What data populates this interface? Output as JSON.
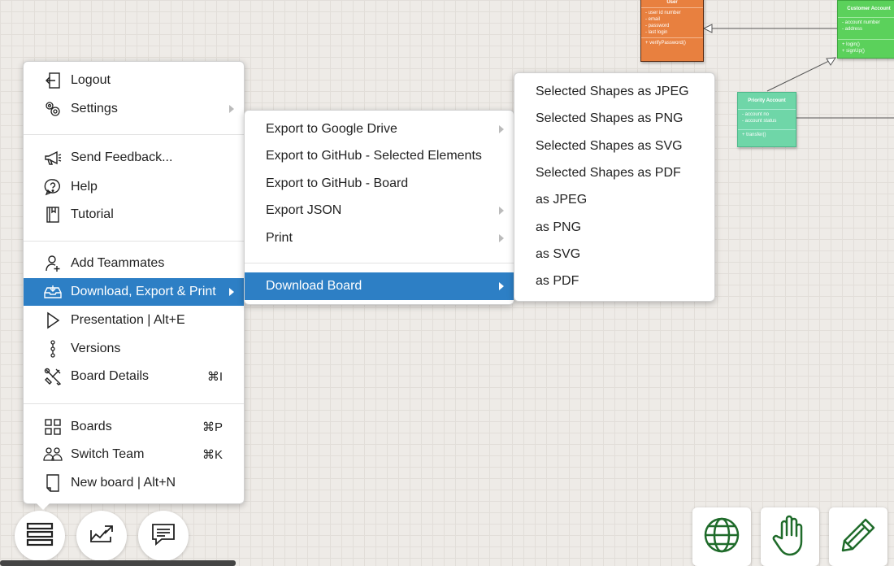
{
  "diagram": {
    "user": {
      "title": "User",
      "attrs": [
        "- user id number",
        "- email",
        "- password",
        "- last login"
      ],
      "methods": [
        "+ verifyPassword()"
      ]
    },
    "customer": {
      "title": "Customer Account",
      "attrs": [
        "- account number",
        "- address"
      ],
      "methods": [
        "+ login()",
        "+ signUp()"
      ]
    },
    "priority": {
      "title": "Priority Account",
      "attrs": [
        "- account no",
        "- account status"
      ],
      "methods": [
        "+ transfer()"
      ]
    }
  },
  "main_menu": {
    "logout": "Logout",
    "settings": "Settings",
    "send_feedback": "Send Feedback...",
    "help": "Help",
    "tutorial": "Tutorial",
    "add_teammates": "Add Teammates",
    "download_export_print": "Download, Export & Print",
    "presentation": "Presentation | Alt+E",
    "versions": "Versions",
    "board_details": "Board Details",
    "board_details_shortcut": "⌘I",
    "boards": "Boards",
    "boards_shortcut": "⌘P",
    "switch_team": "Switch Team",
    "switch_team_shortcut": "⌘K",
    "new_board": "New board | Alt+N"
  },
  "export_menu": {
    "google_drive": "Export to Google Drive",
    "github_selected": "Export to GitHub - Selected Elements",
    "github_board": "Export to GitHub - Board",
    "json": "Export JSON",
    "print": "Print",
    "download_board": "Download Board"
  },
  "download_menu": {
    "items": [
      "Selected Shapes as JPEG",
      "Selected Shapes as PNG",
      "Selected Shapes as SVG",
      "Selected Shapes as PDF",
      "as JPEG",
      "as PNG",
      "as SVG",
      "as PDF"
    ]
  },
  "colors": {
    "accent": "#2d7fc5",
    "icon_green": "#1f6b2a",
    "user_class": "#e8803f",
    "customer_class": "#5bd15b",
    "priority_class": "#6fd6a8"
  },
  "icons": {
    "bottom_left": [
      "menu-icon",
      "share-icon",
      "chat-icon"
    ],
    "bottom_right": [
      "globe-icon",
      "hand-icon",
      "pencil-icon"
    ]
  }
}
